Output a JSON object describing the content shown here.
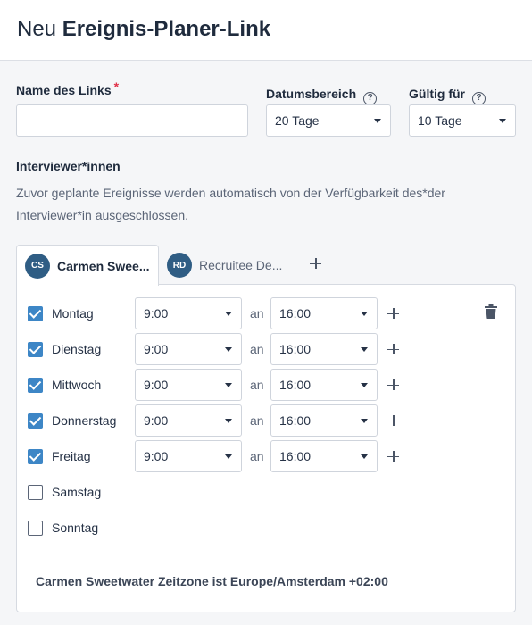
{
  "header": {
    "prefix": "Neu",
    "title": "Ereignis-Planer-Link"
  },
  "form": {
    "name_label": "Name des Links",
    "required_mark": "*",
    "name_value": "",
    "date_range_label": "Datumsbereich",
    "date_range_value": "20 Tage",
    "valid_for_label": "Gültig für",
    "valid_for_value": "10 Tage",
    "help_glyph": "?"
  },
  "interviewers": {
    "heading": "Interviewer*innen",
    "description": "Zuvor geplante Ereignisse werden automatisch von der Verfügbarkeit des*der Interviewer*in ausgeschlossen.",
    "tabs": [
      {
        "initials": "CS",
        "name": "Carmen Swee...",
        "active": true
      },
      {
        "initials": "RD",
        "name": "Recruitee De...",
        "active": false
      }
    ]
  },
  "schedule": {
    "connector": "an",
    "days": [
      {
        "day": "Montag",
        "checked": true,
        "from": "9:00",
        "to": "16:00"
      },
      {
        "day": "Dienstag",
        "checked": true,
        "from": "9:00",
        "to": "16:00"
      },
      {
        "day": "Mittwoch",
        "checked": true,
        "from": "9:00",
        "to": "16:00"
      },
      {
        "day": "Donnerstag",
        "checked": true,
        "from": "9:00",
        "to": "16:00"
      },
      {
        "day": "Freitag",
        "checked": true,
        "from": "9:00",
        "to": "16:00"
      },
      {
        "day": "Samstag",
        "checked": false
      },
      {
        "day": "Sonntag",
        "checked": false
      }
    ],
    "timezone_note": "Carmen Sweetwater Zeitzone ist Europe/Amsterdam +02:00"
  },
  "colors": {
    "accent": "#3d86c6",
    "avatar": "#2f5d84",
    "required": "#e0334a"
  }
}
